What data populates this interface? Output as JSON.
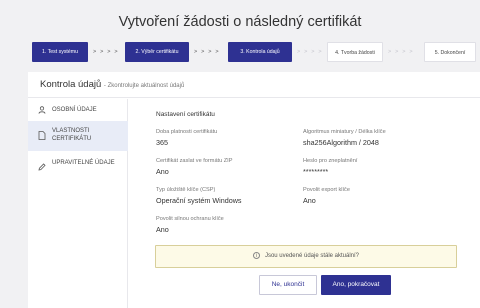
{
  "page": {
    "title": "Vytvoření žádosti o následný certifikát"
  },
  "steps": [
    {
      "label": "1. Test systému",
      "state": "active"
    },
    {
      "label": "2. Výběr certifikátu",
      "state": "active"
    },
    {
      "label": "3. Kontrola údajů",
      "state": "active"
    },
    {
      "label": "4. Tvorba žádosti",
      "state": "inactive"
    },
    {
      "label": "5. Dokončení",
      "state": "inactive"
    }
  ],
  "step_separator": "> > > >",
  "card": {
    "title": "Kontrola údajů",
    "subtitle": "- Zkontrolujte aktuálnost údajů"
  },
  "sidebar": {
    "items": [
      {
        "label": "OSOBNÍ ÚDAJE",
        "icon": "person-icon",
        "active": false
      },
      {
        "label": "VLASTNOSTI CERTIFIKÁTU",
        "icon": "document-icon",
        "active": true
      },
      {
        "label": "UPRAVITELNÉ ÚDAJE",
        "icon": "pencil-icon",
        "active": false
      }
    ]
  },
  "section": {
    "title": "Nastavení certifikátu",
    "fields": [
      {
        "label": "Doba platnosti certifikátu",
        "value": "365"
      },
      {
        "label": "Algoritmus miniatury / Délka klíče",
        "value": "sha256Algorithm / 2048"
      },
      {
        "label": "Certifikát zaslat ve formátu ZIP",
        "value": "Ano"
      },
      {
        "label": "Heslo pro zneplatnění",
        "value": "*********"
      },
      {
        "label": "Typ úložiště klíče (CSP)",
        "value": "Operační systém Windows"
      },
      {
        "label": "Povolit export klíče",
        "value": "Ano"
      },
      {
        "label": "Povolit silnou ochranu klíče",
        "value": "Ano"
      }
    ]
  },
  "notice": {
    "icon": "info-icon",
    "glyph": "i",
    "text": "Jsou uvedené údaje stále aktuální?"
  },
  "buttons": {
    "no": "Ne, ukončit",
    "yes": "Ano, pokračovat"
  },
  "colors": {
    "primary": "#2e3192",
    "sidebar_active_bg": "#e8ecf7",
    "notice_bg": "#fdfae7",
    "notice_border": "#d8cf9a"
  }
}
